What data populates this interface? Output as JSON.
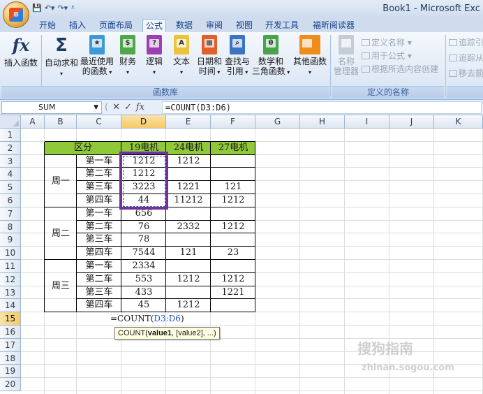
{
  "window": {
    "title": "Book1 - Microsoft Exc"
  },
  "qat": {
    "save_icon": "save-icon",
    "undo_icon": "undo-icon",
    "redo_icon": "redo-icon"
  },
  "tabs": [
    "开始",
    "插入",
    "页面布局",
    "公式",
    "数据",
    "审阅",
    "视图",
    "开发工具",
    "福昕阅读器"
  ],
  "active_tab": "公式",
  "ribbon": {
    "insert_function": "插入函数",
    "autosum": "自动求和",
    "recent": [
      "最近使用",
      "的函数"
    ],
    "financial": "财务",
    "logical": "逻辑",
    "text": "文本",
    "datetime": [
      "日期和",
      "时间"
    ],
    "lookup": [
      "查找与",
      "引用"
    ],
    "math": [
      "数学和",
      "三角函数"
    ],
    "more": "其他函数",
    "group_library": "函数库",
    "name_manager": [
      "名称",
      "管理器"
    ],
    "define_name": "定义名称",
    "use_in_formula": "用于公式",
    "create_from_sel": "根据所选内容创建",
    "group_defined": "定义的名称",
    "trace_precedents": "追踪引",
    "trace_dependents": "追踪从",
    "remove_arrows": "移去箭"
  },
  "formula_bar": {
    "name_box": "SUM",
    "formula": "=COUNT(D3:D6)"
  },
  "columns": [
    "A",
    "B",
    "C",
    "D",
    "E",
    "F",
    "G",
    "H",
    "I",
    "J",
    "K"
  ],
  "rows": [
    "1",
    "2",
    "3",
    "4",
    "5",
    "6",
    "7",
    "8",
    "9",
    "10",
    "11",
    "12",
    "13",
    "14",
    "15",
    "16",
    "17",
    "18",
    "19",
    "20"
  ],
  "table": {
    "header": [
      "区分",
      "19电机",
      "24电机",
      "27电机"
    ],
    "groups": [
      {
        "label": "周一",
        "rows": [
          {
            "car": "第一车",
            "d": "1212",
            "e": "1212",
            "f": ""
          },
          {
            "car": "第二车",
            "d": "1212",
            "e": "",
            "f": ""
          },
          {
            "car": "第三车",
            "d": "3223",
            "e": "1221",
            "f": "121"
          },
          {
            "car": "第四车",
            "d": "44",
            "e": "11212",
            "f": "1212"
          }
        ]
      },
      {
        "label": "周二",
        "rows": [
          {
            "car": "第一车",
            "d": "656",
            "e": "",
            "f": ""
          },
          {
            "car": "第二车",
            "d": "76",
            "e": "2332",
            "f": "1212"
          },
          {
            "car": "第三车",
            "d": "78",
            "e": "",
            "f": ""
          },
          {
            "car": "第四车",
            "d": "7544",
            "e": "121",
            "f": "23"
          }
        ]
      },
      {
        "label": "周三",
        "rows": [
          {
            "car": "第一车",
            "d": "2334",
            "e": "",
            "f": ""
          },
          {
            "car": "第二车",
            "d": "553",
            "e": "1212",
            "f": "1212"
          },
          {
            "car": "第三车",
            "d": "433",
            "e": "",
            "f": "1221"
          },
          {
            "car": "第四车",
            "d": "45",
            "e": "1212",
            "f": ""
          }
        ]
      }
    ]
  },
  "editing": {
    "prefix": "=COUNT(",
    "range": "D3:D6",
    "suffix": ")"
  },
  "tooltip": {
    "fn": "COUNT(",
    "arg1": "value1",
    "rest": ", [value2], ...)"
  },
  "watermark": {
    "line1": "搜狗指南",
    "line2": "zhinan.sogou.com"
  }
}
